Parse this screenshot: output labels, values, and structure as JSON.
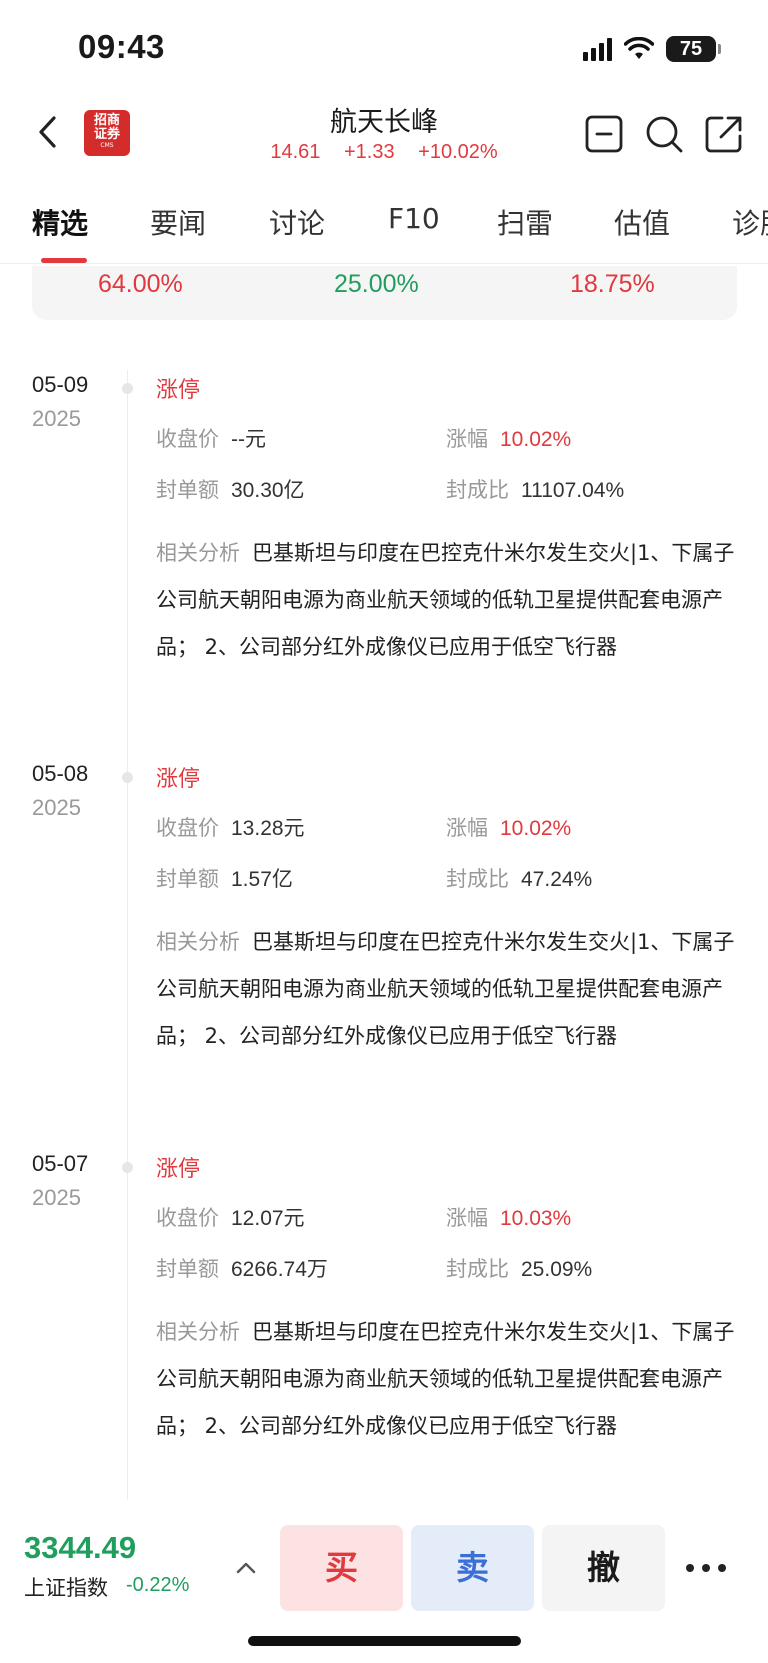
{
  "status": {
    "time": "09:43",
    "battery": "75"
  },
  "header": {
    "logo_line1": "招商",
    "logo_line2": "证券",
    "logo_sub": "CMS",
    "stock_name": "航天长峰",
    "price": "14.61",
    "change": "+1.33",
    "change_pct": "+10.02%"
  },
  "tabs": [
    "精选",
    "要闻",
    "讨论",
    "F10",
    "扫雷",
    "估值",
    "诊股"
  ],
  "active_tab": "精选",
  "summary": {
    "values": [
      "64.00%",
      "25.00%",
      "18.75%"
    ]
  },
  "labels": {
    "close": "收盘价",
    "rise": "涨幅",
    "seal_amount": "封单额",
    "seal_ratio": "封成比",
    "analysis": "相关分析"
  },
  "entries": [
    {
      "date": "05-09",
      "year": "2025",
      "type": "涨停",
      "close": "--元",
      "rise": "10.02%",
      "seal_amount": "30.30亿",
      "seal_ratio": "11107.04%",
      "analysis": "巴基斯坦与印度在巴控克什米尔发生交火|1、下属子公司航天朝阳电源为商业航天领域的低轨卫星提供配套电源产品； 2、公司部分红外成像仪已应用于低空飞行器"
    },
    {
      "date": "05-08",
      "year": "2025",
      "type": "涨停",
      "close": "13.28元",
      "rise": "10.02%",
      "seal_amount": "1.57亿",
      "seal_ratio": "47.24%",
      "analysis": "巴基斯坦与印度在巴控克什米尔发生交火|1、下属子公司航天朝阳电源为商业航天领域的低轨卫星提供配套电源产品； 2、公司部分红外成像仪已应用于低空飞行器"
    },
    {
      "date": "05-07",
      "year": "2025",
      "type": "涨停",
      "close": "12.07元",
      "rise": "10.03%",
      "seal_amount": "6266.74万",
      "seal_ratio": "25.09%",
      "analysis": "巴基斯坦与印度在巴控克什米尔发生交火|1、下属子公司航天朝阳电源为商业航天领域的低轨卫星提供配套电源产品； 2、公司部分红外成像仪已应用于低空飞行器"
    }
  ],
  "bottom": {
    "index_value": "3344.49",
    "index_name": "上证指数",
    "index_change": "-0.22%",
    "buy": "买",
    "sell": "卖",
    "cancel": "撤"
  },
  "colors": {
    "up": "#e0393e",
    "down": "#1f9e5d",
    "sell": "#3c6fd6"
  },
  "icons": [
    "back-icon",
    "minus-square-icon",
    "search-icon",
    "share-icon",
    "chevron-up-icon",
    "more-icon"
  ]
}
